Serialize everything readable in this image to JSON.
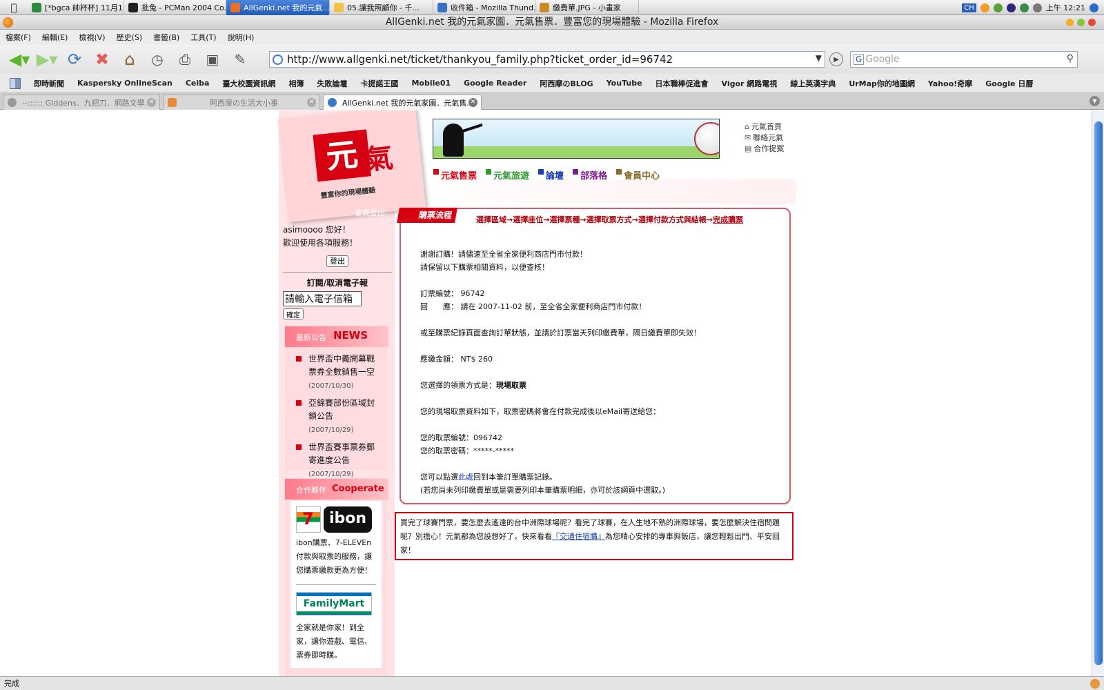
{
  "os_taskbar": {
    "tasks": [
      {
        "label": "[*bgca 帥杯杯]  11月1...",
        "color": "#2c8a3e",
        "active": false
      },
      {
        "label": "批兔 - PCMan 2004 Co...",
        "color": "#222222",
        "active": false
      },
      {
        "label": "AllGenki.net 我的元氣...",
        "color": "#e8702a",
        "active": true
      },
      {
        "label": "05.讓我照顧你 - 千...",
        "color": "#f2c24a",
        "active": false
      },
      {
        "label": "收件箱 - Mozilla Thund...",
        "color": "#3a6fc4",
        "active": false
      },
      {
        "label": "繳費單.JPG - 小畫家",
        "color": "#c98a2a",
        "active": false
      }
    ],
    "ime": "CH",
    "clock": "上午 12:21"
  },
  "window": {
    "title": "AllGenki.net 我的元氣家園．元氣售票．豐富您的現場體驗 - Mozilla Firefox"
  },
  "menu": [
    "檔案(F)",
    "編輯(E)",
    "檢視(V)",
    "歷史(S)",
    "書籤(B)",
    "工具(T)",
    "說明(H)"
  ],
  "address_bar": {
    "url": "http://www.allgenki.net/ticket/thankyou_family.php?ticket_order_id=96742"
  },
  "search_bar": {
    "placeholder": "Google"
  },
  "bookmarks": [
    "即時新聞",
    "Kaspersky OnlineScan",
    "Ceiba",
    "臺大校園資訊網",
    "相簿",
    "失敗論壇",
    "卡提諾王國",
    "Mobile01",
    "Google Reader",
    "阿西摩のBLOG",
    "YouTube",
    "日本職棒促進會",
    "Vigor 網路電視",
    "線上英漢字典",
    "UrMap你的地圖網",
    "Yahoo!奇摩",
    "Google 日曆"
  ],
  "tabs": [
    {
      "label": "--:::::: Giddens．九把刀．網路文學...",
      "active": false
    },
    {
      "label": "阿西摩の生活大小事",
      "active": false
    },
    {
      "label": "AllGenki.net 我的元氣家園．元氣售...",
      "active": true
    }
  ],
  "site": {
    "logo_tagline": "豐富你的現場體驗",
    "member_logout_tag": "會員登出",
    "top_links": [
      "元氣首頁",
      "聯絡元氣",
      "合作提案"
    ],
    "nav": [
      {
        "label": "元氣售票",
        "color": "#d60012"
      },
      {
        "label": "元氣旅遊",
        "color": "#2e9a2e"
      },
      {
        "label": "論壇",
        "color": "#1a3fb0"
      },
      {
        "label": "部落格",
        "color": "#7a1f8c"
      },
      {
        "label": "會員中心",
        "color": "#8a6a2a"
      }
    ]
  },
  "sidebar": {
    "greeting": "asimoooo 您好！",
    "welcome": "歡迎使用各項服務！",
    "logout_label": "登出",
    "epaper_title": "訂閱/取消電子報",
    "email_value": "請輸入電子信箱",
    "confirm_label": "確定",
    "news": {
      "zh": "最新公告",
      "en": "NEWS",
      "items": [
        {
          "title": "世界盃中義開幕戰票券全數銷售一空",
          "date": "(2007/10/30)"
        },
        {
          "title": "亞錦賽部份區域封鎖公告",
          "date": "(2007/10/29)"
        },
        {
          "title": "世界盃賽事票券郵寄進度公告",
          "date": "(2007/10/29)"
        }
      ]
    },
    "cooperate": {
      "zh": "合作夥伴",
      "en": "Cooperate",
      "seven_label": "7",
      "ibon_label": "ibon",
      "ibon_text": "ibon購票、7-ELEVEn付款與取票的服務，讓您購票繳款更為方便！",
      "familymart_label": "FamilyMart",
      "familymart_text": "全家就是你家！到全家，讓你遊戲、電信、票券即時購。"
    }
  },
  "main": {
    "flow_tag": "購票流程",
    "flow_steps": "選擇區域→選擇座位→選擇票種→選擇取票方式→選擇付款方式與結帳→",
    "flow_done": "完成購票",
    "thanks_1": "謝謝訂購！請儘速至全省全家便利商店門市付款！",
    "thanks_2": "請保留以下購票相關資料，以便查核！",
    "order_no_label": "訂票編號：",
    "order_no": "96742",
    "reply_label": "回　　應：",
    "reply_text": "請在 2007-11-02 前，至全省全家便利商店門市付款！",
    "record_note": "或至購票紀錄頁面查詢訂單狀態，並請於訂票當天列印繳費單，隔日繳費單即失效！",
    "amount_label": "應繳金額：",
    "amount": "NT$ 260",
    "pickup_label": "您選擇的領票方式是：",
    "pickup_method": "現場取票",
    "pickup_info": "您的現場取票資料如下，取票密碼將會在付款完成後以eMail寄送給您：",
    "pickup_no_label": "您的取票編號：",
    "pickup_no": "096742",
    "pickup_pw_label": "您的取票密碼：",
    "pickup_pw": "*****-*****",
    "back_prefix": "您可以點選",
    "back_link": "此處",
    "back_suffix": "回到本筆訂單購票記錄。",
    "print_note": "(若您尚未列印繳費單或是需要列印本筆購票明細，亦可於該網頁中選取。)"
  },
  "note": {
    "text_before": "買完了球賽門票，要怎麼去遙遠的台中洲際球場呢？看完了球賽，在人生地不熟的洲際球場，要怎麼解決住宿問題呢？別擔心！元氣都為您設想好了，快來看看",
    "link": "『交通住宿購』",
    "text_after": "為您精心安排的專車與飯店，讓您輕鬆出門、平安回家！"
  },
  "status": "完成"
}
